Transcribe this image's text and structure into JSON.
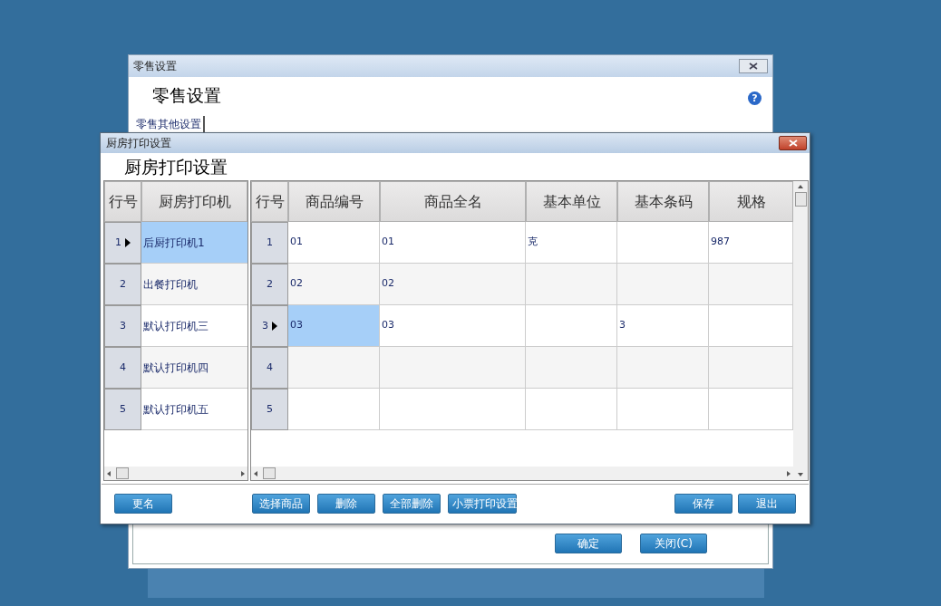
{
  "retail_window": {
    "title": "零售设置",
    "heading": "零售设置",
    "help": "?",
    "tabs": [
      {
        "label": "零售其他设置",
        "selected": true
      }
    ],
    "buttons": [
      "确定",
      "关闭(C)"
    ]
  },
  "kitchen_dialog": {
    "title": "厨房打印设置",
    "heading": "厨房打印设置",
    "printers": {
      "columns": [
        "行号",
        "厨房打印机"
      ],
      "rows": [
        {
          "row_no": "1",
          "name": "后厨打印机1",
          "selected": true
        },
        {
          "row_no": "2",
          "name": "出餐打印机",
          "selected": false
        },
        {
          "row_no": "3",
          "name": "默认打印机三",
          "selected": false
        },
        {
          "row_no": "4",
          "name": "默认打印机四",
          "selected": false
        },
        {
          "row_no": "5",
          "name": "默认打印机五",
          "selected": false
        }
      ]
    },
    "items": {
      "columns": [
        "行号",
        "商品编号",
        "商品全名",
        "基本单位",
        "基本条码",
        "规格"
      ],
      "rows": [
        {
          "row_no": "1",
          "cells": [
            "01",
            "01",
            "克",
            null,
            "987"
          ],
          "selected": false
        },
        {
          "row_no": "2",
          "cells": [
            "02",
            "02",
            null,
            null,
            null
          ],
          "selected": false
        },
        {
          "row_no": "3",
          "cells": [
            "03",
            "03",
            null,
            "3",
            null
          ],
          "selected": true
        },
        {
          "row_no": "4",
          "cells": [
            null,
            null,
            null,
            null,
            null
          ],
          "selected": false
        },
        {
          "row_no": "5",
          "cells": [
            null,
            null,
            null,
            null,
            null
          ],
          "selected": false
        }
      ]
    },
    "left_buttons": [
      "更名"
    ],
    "middle_buttons": [
      "选择商品",
      "删除",
      "全部删除",
      "小票打印设置"
    ],
    "right_buttons": [
      "保存",
      "退出"
    ]
  }
}
